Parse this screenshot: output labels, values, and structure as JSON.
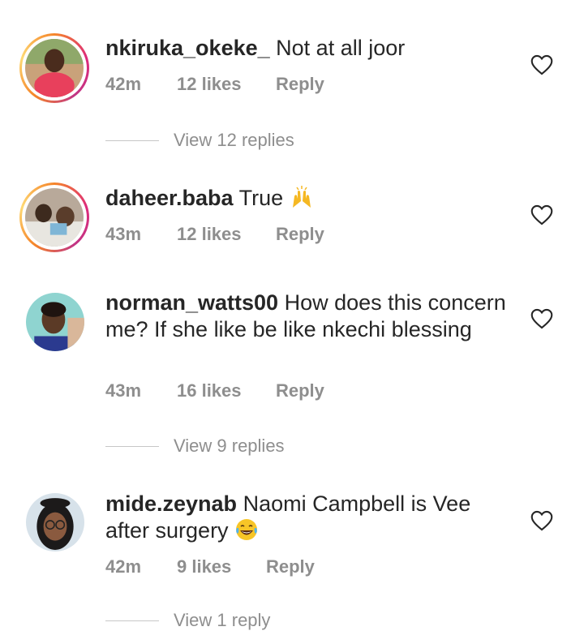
{
  "comments": [
    {
      "username": "nkiruka_okeke_",
      "text": "Not at all joor",
      "time": "42m",
      "likes": "12 likes",
      "reply": "Reply",
      "view_replies": "View 12 replies"
    },
    {
      "username": "daheer.baba",
      "text": "True",
      "time": "43m",
      "likes": "12 likes",
      "reply": "Reply"
    },
    {
      "username": "norman_watts00",
      "text": "How does this concern me? If she like be like nkechi blessing",
      "time": "43m",
      "likes": "16 likes",
      "reply": "Reply",
      "view_replies": "View 9 replies"
    },
    {
      "username": "mide.zeynab",
      "text": "Naomi Campbell is Vee after surgery",
      "time": "42m",
      "likes": "9 likes",
      "reply": "Reply",
      "view_replies": "View 1 reply"
    }
  ],
  "colors": {
    "story_ring": "#dd2a7b",
    "meta_gray": "#8e8e8e",
    "text": "#262626"
  },
  "icons": [
    "heart-icon",
    "raised-hands-emoji",
    "tears-of-joy-emoji"
  ]
}
